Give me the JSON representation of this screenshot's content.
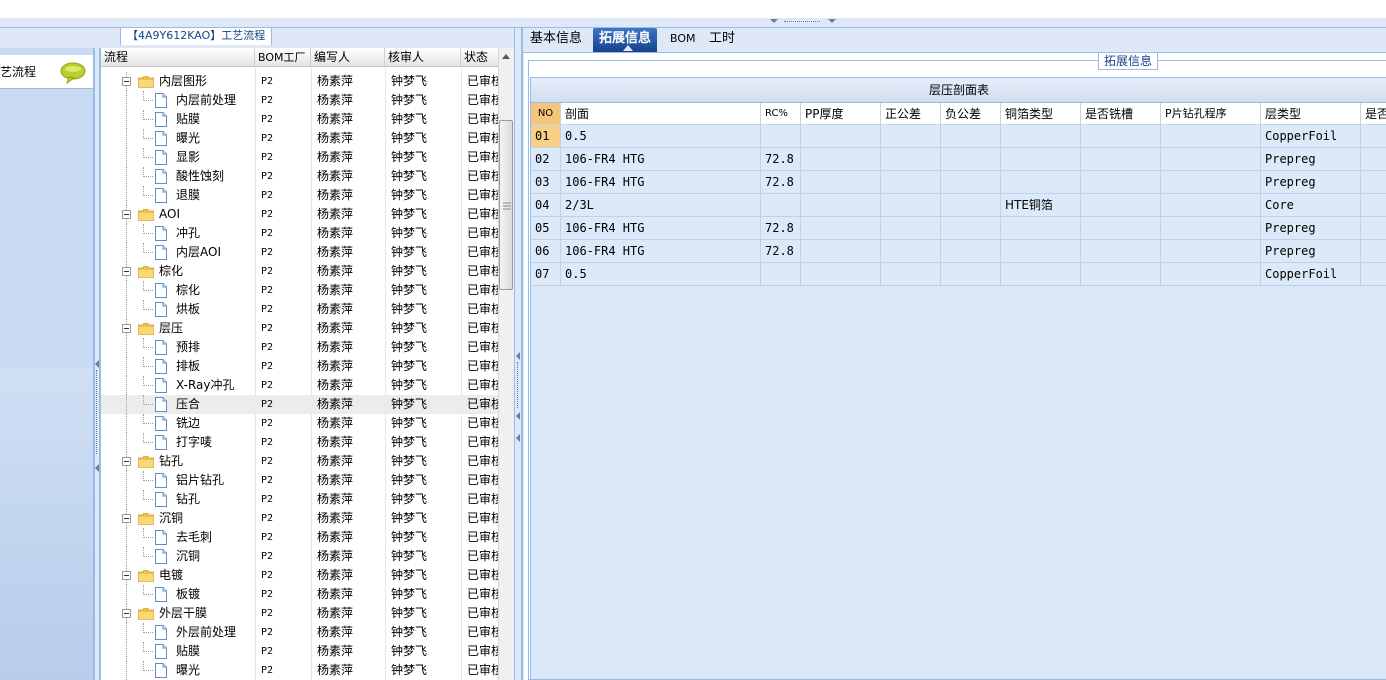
{
  "left_nav": {
    "item_label": "艺流程"
  },
  "flow_panel": {
    "title": "【4A9Y612KAO】工艺流程",
    "columns": [
      "流程",
      "BOM工厂",
      "编写人",
      "核审人",
      "状态"
    ],
    "partial_top": {
      "name": "..."
    },
    "rows": [
      {
        "name": "内层图形",
        "type": "folder",
        "factory": "P2",
        "writer": "杨素萍",
        "reviewer": "钟梦飞",
        "status": "已审核"
      },
      {
        "name": "内层前处理",
        "type": "item",
        "factory": "P2",
        "writer": "杨素萍",
        "reviewer": "钟梦飞",
        "status": "已审核"
      },
      {
        "name": "贴膜",
        "type": "item",
        "factory": "P2",
        "writer": "杨素萍",
        "reviewer": "钟梦飞",
        "status": "已审核"
      },
      {
        "name": "曝光",
        "type": "item",
        "factory": "P2",
        "writer": "杨素萍",
        "reviewer": "钟梦飞",
        "status": "已审核"
      },
      {
        "name": "显影",
        "type": "item",
        "factory": "P2",
        "writer": "杨素萍",
        "reviewer": "钟梦飞",
        "status": "已审核"
      },
      {
        "name": "酸性蚀刻",
        "type": "item",
        "factory": "P2",
        "writer": "杨素萍",
        "reviewer": "钟梦飞",
        "status": "已审核"
      },
      {
        "name": "退膜",
        "type": "item",
        "factory": "P2",
        "writer": "杨素萍",
        "reviewer": "钟梦飞",
        "status": "已审核"
      },
      {
        "name": "AOI",
        "type": "folder",
        "factory": "P2",
        "writer": "杨素萍",
        "reviewer": "钟梦飞",
        "status": "已审核"
      },
      {
        "name": "冲孔",
        "type": "item",
        "factory": "P2",
        "writer": "杨素萍",
        "reviewer": "钟梦飞",
        "status": "已审核"
      },
      {
        "name": "内层AOI",
        "type": "item",
        "factory": "P2",
        "writer": "杨素萍",
        "reviewer": "钟梦飞",
        "status": "已审核"
      },
      {
        "name": "棕化",
        "type": "folder",
        "factory": "P2",
        "writer": "杨素萍",
        "reviewer": "钟梦飞",
        "status": "已审核"
      },
      {
        "name": "棕化",
        "type": "item",
        "factory": "P2",
        "writer": "杨素萍",
        "reviewer": "钟梦飞",
        "status": "已审核"
      },
      {
        "name": "烘板",
        "type": "item",
        "factory": "P2",
        "writer": "杨素萍",
        "reviewer": "钟梦飞",
        "status": "已审核"
      },
      {
        "name": "层压",
        "type": "folder",
        "factory": "P2",
        "writer": "杨素萍",
        "reviewer": "钟梦飞",
        "status": "已审核"
      },
      {
        "name": "预排",
        "type": "item",
        "factory": "P2",
        "writer": "杨素萍",
        "reviewer": "钟梦飞",
        "status": "已审核"
      },
      {
        "name": "排板",
        "type": "item",
        "factory": "P2",
        "writer": "杨素萍",
        "reviewer": "钟梦飞",
        "status": "已审核"
      },
      {
        "name": "X-Ray冲孔",
        "type": "item",
        "factory": "P2",
        "writer": "杨素萍",
        "reviewer": "钟梦飞",
        "status": "已审核"
      },
      {
        "name": "压合",
        "type": "item",
        "factory": "P2",
        "writer": "杨素萍",
        "reviewer": "钟梦飞",
        "status": "已审核",
        "selected": true
      },
      {
        "name": "铣边",
        "type": "item",
        "factory": "P2",
        "writer": "杨素萍",
        "reviewer": "钟梦飞",
        "status": "已审核"
      },
      {
        "name": "打字唛",
        "type": "item",
        "factory": "P2",
        "writer": "杨素萍",
        "reviewer": "钟梦飞",
        "status": "已审核"
      },
      {
        "name": "钻孔",
        "type": "folder",
        "factory": "P2",
        "writer": "杨素萍",
        "reviewer": "钟梦飞",
        "status": "已审核"
      },
      {
        "name": "铝片钻孔",
        "type": "item",
        "factory": "P2",
        "writer": "杨素萍",
        "reviewer": "钟梦飞",
        "status": "已审核"
      },
      {
        "name": "钻孔",
        "type": "item",
        "factory": "P2",
        "writer": "杨素萍",
        "reviewer": "钟梦飞",
        "status": "已审核"
      },
      {
        "name": "沉铜",
        "type": "folder",
        "factory": "P2",
        "writer": "杨素萍",
        "reviewer": "钟梦飞",
        "status": "已审核"
      },
      {
        "name": "去毛刺",
        "type": "item",
        "factory": "P2",
        "writer": "杨素萍",
        "reviewer": "钟梦飞",
        "status": "已审核"
      },
      {
        "name": "沉铜",
        "type": "item",
        "factory": "P2",
        "writer": "杨素萍",
        "reviewer": "钟梦飞",
        "status": "已审核"
      },
      {
        "name": "电镀",
        "type": "folder",
        "factory": "P2",
        "writer": "杨素萍",
        "reviewer": "钟梦飞",
        "status": "已审核"
      },
      {
        "name": "板镀",
        "type": "item",
        "factory": "P2",
        "writer": "杨素萍",
        "reviewer": "钟梦飞",
        "status": "已审核"
      },
      {
        "name": "外层干膜",
        "type": "folder",
        "factory": "P2",
        "writer": "杨素萍",
        "reviewer": "钟梦飞",
        "status": "已审核"
      },
      {
        "name": "外层前处理",
        "type": "item",
        "factory": "P2",
        "writer": "杨素萍",
        "reviewer": "钟梦飞",
        "status": "已审核"
      },
      {
        "name": "贴膜",
        "type": "item",
        "factory": "P2",
        "writer": "杨素萍",
        "reviewer": "钟梦飞",
        "status": "已审核"
      },
      {
        "name": "曝光",
        "type": "item",
        "factory": "P2",
        "writer": "杨素萍",
        "reviewer": "钟梦飞",
        "status": "已审核"
      }
    ]
  },
  "tabs": [
    {
      "label": "基本信息",
      "active": false
    },
    {
      "label": "拓展信息",
      "active": true
    },
    {
      "label": "BOM",
      "active": false
    },
    {
      "label": "工时",
      "active": false
    }
  ],
  "extended_info": {
    "legend": "拓展信息",
    "table_title": "层压剖面表",
    "columns": [
      "NO",
      "剖面",
      "RC%",
      "PP厚度",
      "正公差",
      "负公差",
      "铜箔类型",
      "是否铣槽",
      "P片钻孔程序",
      "层类型",
      "是否"
    ],
    "rows": [
      {
        "no": "01",
        "section": "0.5",
        "rc": "",
        "pp": "",
        "pos": "",
        "neg": "",
        "foil": "",
        "slot": "",
        "drill": "",
        "layer": "CopperFoil"
      },
      {
        "no": "02",
        "section": "106-FR4 HTG",
        "rc": "72.8",
        "pp": "",
        "pos": "",
        "neg": "",
        "foil": "",
        "slot": "",
        "drill": "",
        "layer": "Prepreg"
      },
      {
        "no": "03",
        "section": "106-FR4 HTG",
        "rc": "72.8",
        "pp": "",
        "pos": "",
        "neg": "",
        "foil": "",
        "slot": "",
        "drill": "",
        "layer": "Prepreg"
      },
      {
        "no": "04",
        "section": "2/3L",
        "rc": "",
        "pp": "",
        "pos": "",
        "neg": "",
        "foil": "HTE铜箔",
        "slot": "",
        "drill": "",
        "layer": "Core"
      },
      {
        "no": "05",
        "section": "106-FR4 HTG",
        "rc": "72.8",
        "pp": "",
        "pos": "",
        "neg": "",
        "foil": "",
        "slot": "",
        "drill": "",
        "layer": "Prepreg"
      },
      {
        "no": "06",
        "section": "106-FR4 HTG",
        "rc": "72.8",
        "pp": "",
        "pos": "",
        "neg": "",
        "foil": "",
        "slot": "",
        "drill": "",
        "layer": "Prepreg"
      },
      {
        "no": "07",
        "section": "0.5",
        "rc": "",
        "pp": "",
        "pos": "",
        "neg": "",
        "foil": "",
        "slot": "",
        "drill": "",
        "layer": "CopperFoil"
      }
    ]
  },
  "colors": {
    "accent": "#15428b",
    "panel_bg": "#dfe8f6",
    "border": "#99bbe8",
    "no_highlight": "#f7cf87"
  }
}
